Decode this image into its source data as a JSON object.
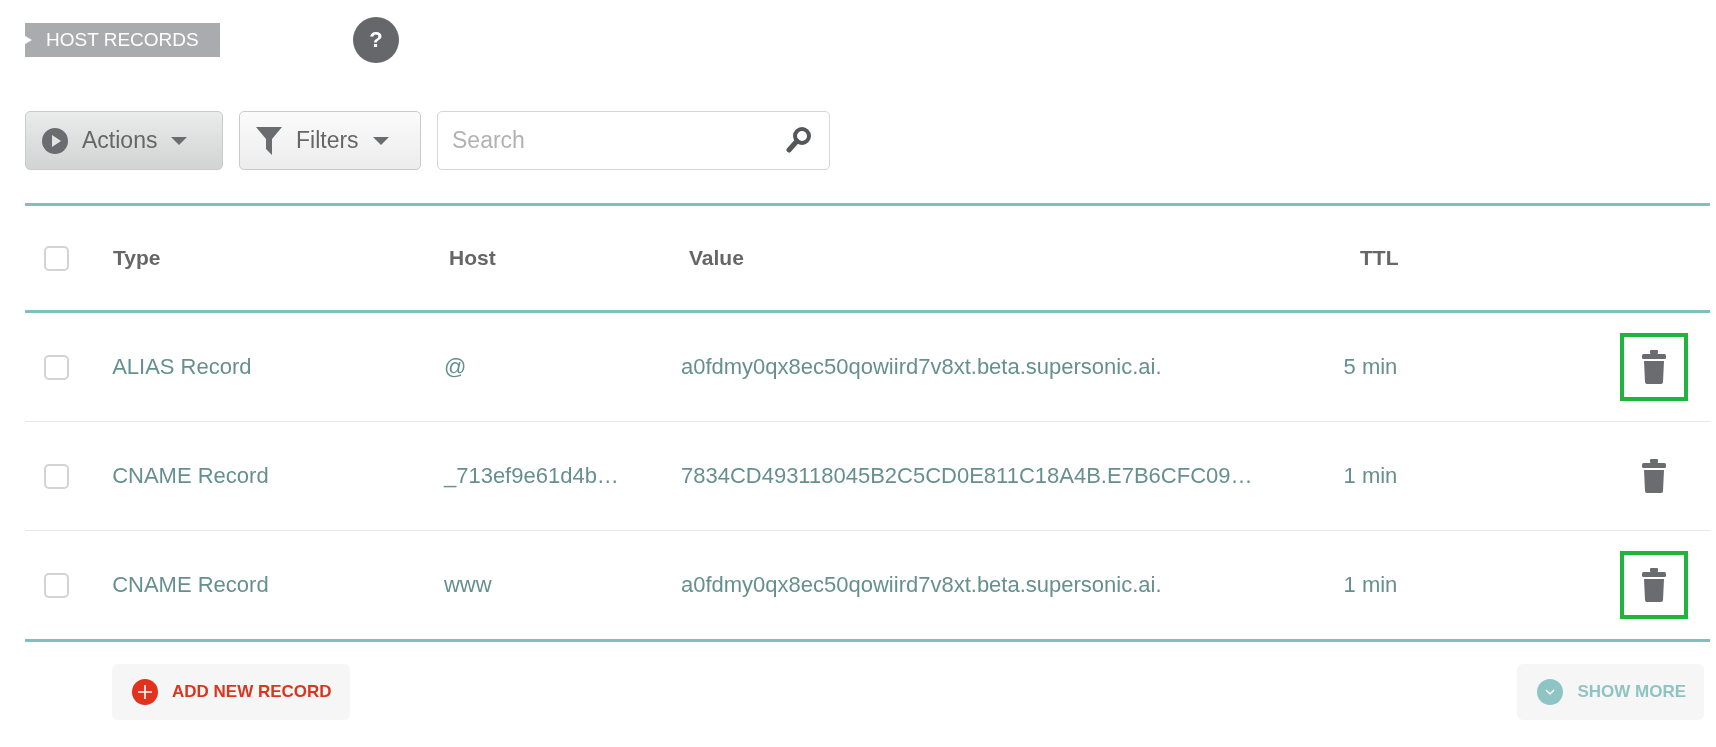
{
  "section_tag": "HOST RECORDS",
  "help_button": "?",
  "toolbar": {
    "actions_button": "Actions",
    "filters_button": "Filters",
    "search": {
      "placeholder": "Search"
    }
  },
  "table": {
    "select_all_checked": false,
    "columns": [
      "Type",
      "Host",
      "Value",
      "TTL"
    ],
    "rows": [
      {
        "checked": false,
        "type": "ALIAS Record",
        "host": "@",
        "value": "a0fdmy0qx8ec50qowiird7v8xt.beta.supersonic.ai.",
        "ttl": "5 min",
        "highlighted": true
      },
      {
        "checked": false,
        "type": "CNAME Record",
        "host": "_713ef9e61d4b…",
        "value": "7834CD493118045B2C5CD0E811C18A4B.E7B6CFC09…",
        "ttl": "1 min",
        "highlighted": false
      },
      {
        "checked": false,
        "type": "CNAME Record",
        "host": "www",
        "value": "a0fdmy0qx8ec50qowiird7v8xt.beta.supersonic.ai.",
        "ttl": "1 min",
        "highlighted": true
      }
    ]
  },
  "footer": {
    "add_button": "ADD NEW RECORD",
    "show_more_button": "SHOW MORE"
  }
}
